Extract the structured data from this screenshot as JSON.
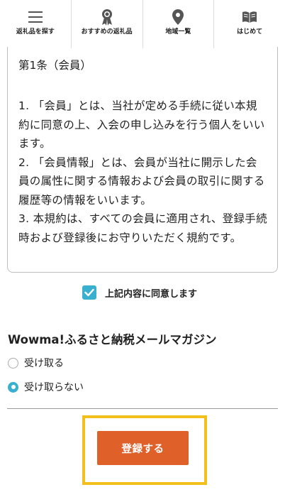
{
  "nav": {
    "items": [
      {
        "label": "返礼品を探す",
        "icon": "menu-icon"
      },
      {
        "label": "おすすめの返礼品",
        "icon": "ribbon-icon"
      },
      {
        "label": "地域一覧",
        "icon": "location-pin-icon"
      },
      {
        "label": "はじめて",
        "icon": "book-icon"
      }
    ]
  },
  "terms": {
    "heading": "第1条（会員）",
    "paragraphs": [
      "1. 「会員」とは、当社が定める手続に従い本規約に同意の上、入会の申し込みを行う個人をいいます。",
      "2. 「会員情報」とは、会員が当社に開示した会員の属性に関する情報および会員の取引に関する履歴等の情報をいいます。",
      "3. 本規約は、すべての会員に適用され、登録手続時および登録後にお守りいただく規約です。"
    ]
  },
  "agree": {
    "label": "上記内容に同意します",
    "checked": true
  },
  "magazine": {
    "title": "Wowma!ふるさと納税メールマガジン",
    "options": [
      {
        "label": "受け取る",
        "selected": false
      },
      {
        "label": "受け取らない",
        "selected": true
      }
    ]
  },
  "submit": {
    "label": "登録する"
  },
  "colors": {
    "accent": "#3ab0d0",
    "button": "#e0602a",
    "highlight": "#f3bf1c"
  }
}
